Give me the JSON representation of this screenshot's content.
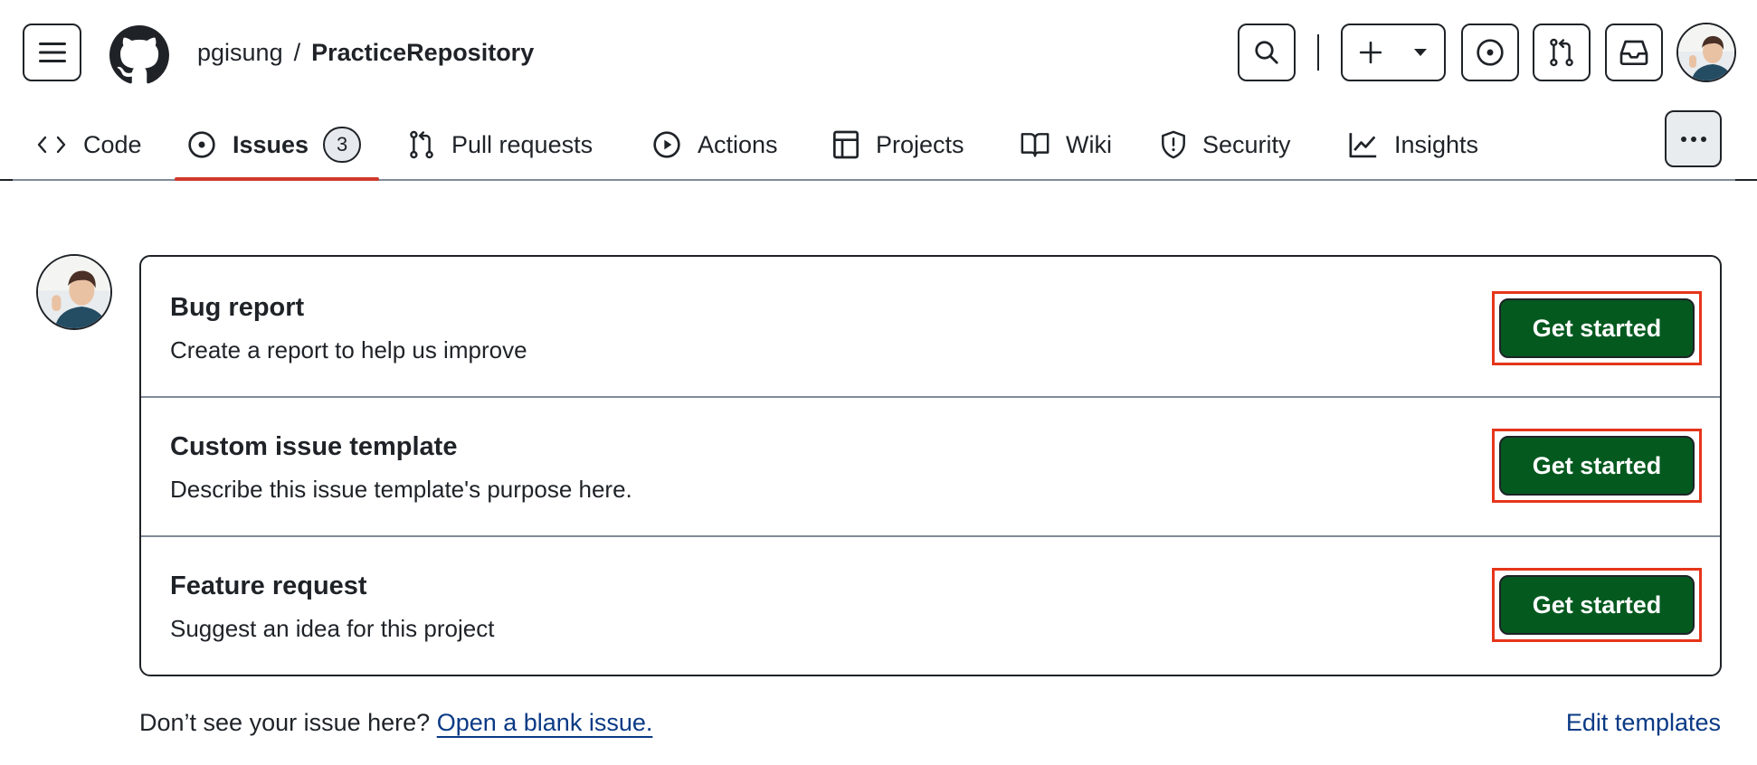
{
  "header": {
    "owner": "pgisung",
    "separator": "/",
    "repo": "PracticeRepository",
    "icons": {
      "menu": "hamburger-icon",
      "logo": "github-mark-icon",
      "search": "search-icon",
      "create": "plus-icon",
      "create_dropdown": "triangle-down-icon",
      "issues": "issue-opened-icon",
      "pull_requests": "git-pull-request-icon",
      "inbox": "inbox-icon",
      "avatar": "user-avatar"
    }
  },
  "nav": {
    "tabs": [
      {
        "label": "Code",
        "icon": "code-icon"
      },
      {
        "label": "Issues",
        "icon": "issue-opened-icon",
        "count": "3",
        "selected": true
      },
      {
        "label": "Pull requests",
        "icon": "git-pull-request-icon"
      },
      {
        "label": "Actions",
        "icon": "play-icon"
      },
      {
        "label": "Projects",
        "icon": "table-icon"
      },
      {
        "label": "Wiki",
        "icon": "book-icon"
      },
      {
        "label": "Security",
        "icon": "shield-icon"
      },
      {
        "label": "Insights",
        "icon": "graph-icon"
      }
    ],
    "more_icon": "kebab-horizontal-icon",
    "active_color": "#cf3a2c"
  },
  "templates": [
    {
      "title": "Bug report",
      "description": "Create a report to help us improve",
      "button": "Get started"
    },
    {
      "title": "Custom issue template",
      "description": "Describe this issue template's purpose here.",
      "button": "Get started"
    },
    {
      "title": "Feature request",
      "description": "Suggest an idea for this project",
      "button": "Get started"
    }
  ],
  "footer": {
    "prompt": "Don’t see your issue here?",
    "blank_issue_link": "Open a blank issue.",
    "edit_templates_link": "Edit templates"
  },
  "colors": {
    "primary_button": "#04591f",
    "link": "#0a3a85",
    "highlight": "#e5351a"
  }
}
